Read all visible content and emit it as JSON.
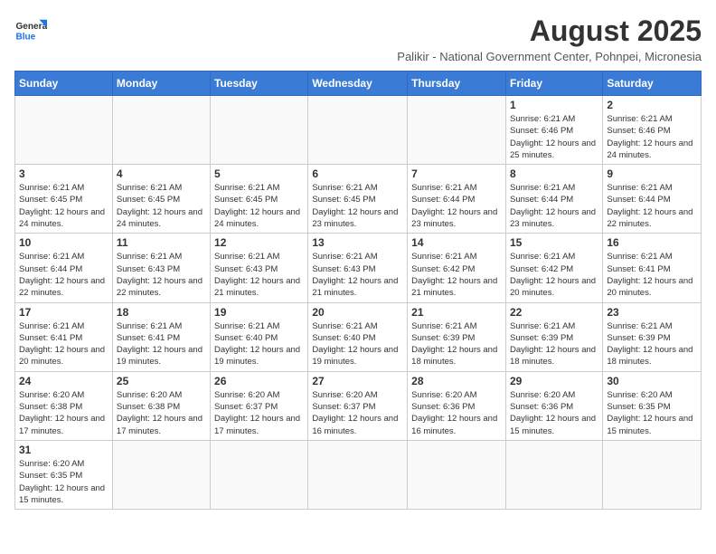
{
  "logo": {
    "text_general": "General",
    "text_blue": "Blue"
  },
  "header": {
    "month_year": "August 2025",
    "subtitle": "Palikir - National Government Center, Pohnpei, Micronesia"
  },
  "weekdays": [
    "Sunday",
    "Monday",
    "Tuesday",
    "Wednesday",
    "Thursday",
    "Friday",
    "Saturday"
  ],
  "weeks": [
    [
      {
        "day": "",
        "info": ""
      },
      {
        "day": "",
        "info": ""
      },
      {
        "day": "",
        "info": ""
      },
      {
        "day": "",
        "info": ""
      },
      {
        "day": "",
        "info": ""
      },
      {
        "day": "1",
        "info": "Sunrise: 6:21 AM\nSunset: 6:46 PM\nDaylight: 12 hours and 25 minutes."
      },
      {
        "day": "2",
        "info": "Sunrise: 6:21 AM\nSunset: 6:46 PM\nDaylight: 12 hours and 24 minutes."
      }
    ],
    [
      {
        "day": "3",
        "info": "Sunrise: 6:21 AM\nSunset: 6:45 PM\nDaylight: 12 hours and 24 minutes."
      },
      {
        "day": "4",
        "info": "Sunrise: 6:21 AM\nSunset: 6:45 PM\nDaylight: 12 hours and 24 minutes."
      },
      {
        "day": "5",
        "info": "Sunrise: 6:21 AM\nSunset: 6:45 PM\nDaylight: 12 hours and 24 minutes."
      },
      {
        "day": "6",
        "info": "Sunrise: 6:21 AM\nSunset: 6:45 PM\nDaylight: 12 hours and 23 minutes."
      },
      {
        "day": "7",
        "info": "Sunrise: 6:21 AM\nSunset: 6:44 PM\nDaylight: 12 hours and 23 minutes."
      },
      {
        "day": "8",
        "info": "Sunrise: 6:21 AM\nSunset: 6:44 PM\nDaylight: 12 hours and 23 minutes."
      },
      {
        "day": "9",
        "info": "Sunrise: 6:21 AM\nSunset: 6:44 PM\nDaylight: 12 hours and 22 minutes."
      }
    ],
    [
      {
        "day": "10",
        "info": "Sunrise: 6:21 AM\nSunset: 6:44 PM\nDaylight: 12 hours and 22 minutes."
      },
      {
        "day": "11",
        "info": "Sunrise: 6:21 AM\nSunset: 6:43 PM\nDaylight: 12 hours and 22 minutes."
      },
      {
        "day": "12",
        "info": "Sunrise: 6:21 AM\nSunset: 6:43 PM\nDaylight: 12 hours and 21 minutes."
      },
      {
        "day": "13",
        "info": "Sunrise: 6:21 AM\nSunset: 6:43 PM\nDaylight: 12 hours and 21 minutes."
      },
      {
        "day": "14",
        "info": "Sunrise: 6:21 AM\nSunset: 6:42 PM\nDaylight: 12 hours and 21 minutes."
      },
      {
        "day": "15",
        "info": "Sunrise: 6:21 AM\nSunset: 6:42 PM\nDaylight: 12 hours and 20 minutes."
      },
      {
        "day": "16",
        "info": "Sunrise: 6:21 AM\nSunset: 6:41 PM\nDaylight: 12 hours and 20 minutes."
      }
    ],
    [
      {
        "day": "17",
        "info": "Sunrise: 6:21 AM\nSunset: 6:41 PM\nDaylight: 12 hours and 20 minutes."
      },
      {
        "day": "18",
        "info": "Sunrise: 6:21 AM\nSunset: 6:41 PM\nDaylight: 12 hours and 19 minutes."
      },
      {
        "day": "19",
        "info": "Sunrise: 6:21 AM\nSunset: 6:40 PM\nDaylight: 12 hours and 19 minutes."
      },
      {
        "day": "20",
        "info": "Sunrise: 6:21 AM\nSunset: 6:40 PM\nDaylight: 12 hours and 19 minutes."
      },
      {
        "day": "21",
        "info": "Sunrise: 6:21 AM\nSunset: 6:39 PM\nDaylight: 12 hours and 18 minutes."
      },
      {
        "day": "22",
        "info": "Sunrise: 6:21 AM\nSunset: 6:39 PM\nDaylight: 12 hours and 18 minutes."
      },
      {
        "day": "23",
        "info": "Sunrise: 6:21 AM\nSunset: 6:39 PM\nDaylight: 12 hours and 18 minutes."
      }
    ],
    [
      {
        "day": "24",
        "info": "Sunrise: 6:20 AM\nSunset: 6:38 PM\nDaylight: 12 hours and 17 minutes."
      },
      {
        "day": "25",
        "info": "Sunrise: 6:20 AM\nSunset: 6:38 PM\nDaylight: 12 hours and 17 minutes."
      },
      {
        "day": "26",
        "info": "Sunrise: 6:20 AM\nSunset: 6:37 PM\nDaylight: 12 hours and 17 minutes."
      },
      {
        "day": "27",
        "info": "Sunrise: 6:20 AM\nSunset: 6:37 PM\nDaylight: 12 hours and 16 minutes."
      },
      {
        "day": "28",
        "info": "Sunrise: 6:20 AM\nSunset: 6:36 PM\nDaylight: 12 hours and 16 minutes."
      },
      {
        "day": "29",
        "info": "Sunrise: 6:20 AM\nSunset: 6:36 PM\nDaylight: 12 hours and 15 minutes."
      },
      {
        "day": "30",
        "info": "Sunrise: 6:20 AM\nSunset: 6:35 PM\nDaylight: 12 hours and 15 minutes."
      }
    ],
    [
      {
        "day": "31",
        "info": "Sunrise: 6:20 AM\nSunset: 6:35 PM\nDaylight: 12 hours and 15 minutes."
      },
      {
        "day": "",
        "info": ""
      },
      {
        "day": "",
        "info": ""
      },
      {
        "day": "",
        "info": ""
      },
      {
        "day": "",
        "info": ""
      },
      {
        "day": "",
        "info": ""
      },
      {
        "day": "",
        "info": ""
      }
    ]
  ]
}
